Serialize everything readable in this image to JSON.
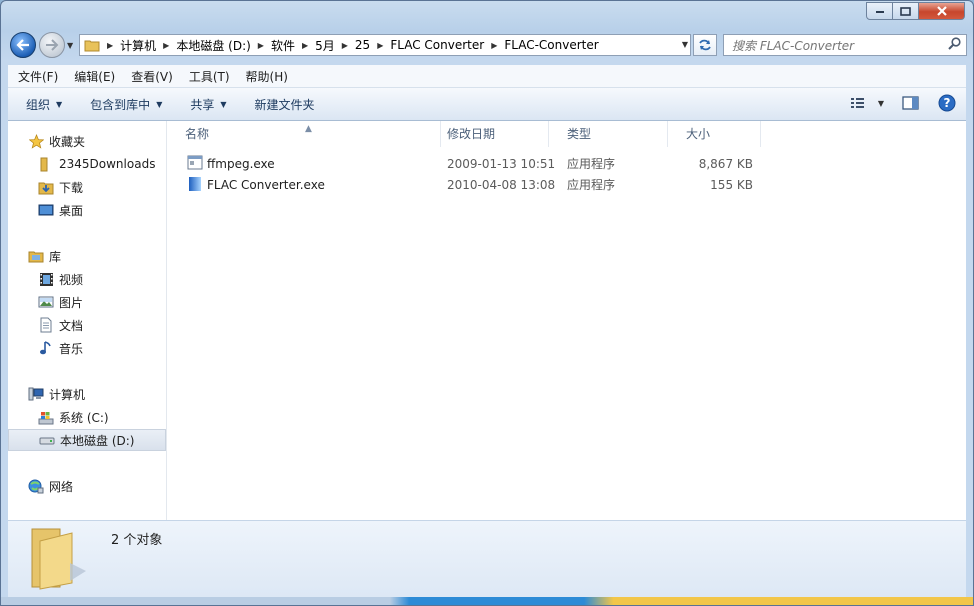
{
  "window": {
    "caption_buttons": {
      "minimize": "minimize-icon",
      "maximize": "maximize-icon",
      "close": "close-icon"
    }
  },
  "breadcrumb": [
    "计算机",
    "本地磁盘 (D:)",
    "软件",
    "5月",
    "25",
    "FLAC Converter",
    "FLAC-Converter"
  ],
  "search": {
    "placeholder": "搜索 FLAC-Converter"
  },
  "menubar": [
    "文件(F)",
    "编辑(E)",
    "查看(V)",
    "工具(T)",
    "帮助(H)"
  ],
  "toolbar": {
    "organize": "组织",
    "include_in_library": "包含到库中",
    "share": "共享",
    "new_folder": "新建文件夹"
  },
  "nav": {
    "favorites": {
      "label": "收藏夹",
      "items": [
        "2345Downloads",
        "下载",
        "桌面"
      ]
    },
    "libraries": {
      "label": "库",
      "items": [
        "视频",
        "图片",
        "文档",
        "音乐"
      ]
    },
    "computer": {
      "label": "计算机",
      "items": [
        "系统 (C:)",
        "本地磁盘 (D:)"
      ]
    },
    "network": {
      "label": "网络"
    }
  },
  "columns": {
    "name": "名称",
    "date": "修改日期",
    "type": "类型",
    "size": "大小"
  },
  "files": [
    {
      "name": "ffmpeg.exe",
      "date": "2009-01-13 10:51",
      "type": "应用程序",
      "size": "8,867 KB"
    },
    {
      "name": "FLAC Converter.exe",
      "date": "2010-04-08 13:08",
      "type": "应用程序",
      "size": "155 KB"
    }
  ],
  "details": {
    "count": "2 个对象"
  },
  "colors": {
    "accent": "#2d8bd6",
    "selection": "#d9e1ec"
  }
}
